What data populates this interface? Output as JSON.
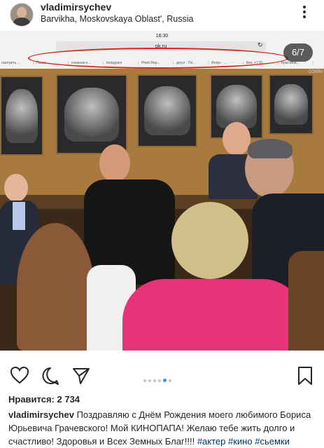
{
  "header": {
    "username": "vladimirsychev",
    "location": "Barvikha, Moskovskaya Oblast', Russia"
  },
  "screenshot_overlay": {
    "time": "16:30",
    "url": "ok.ru",
    "tabs": [
      "смотреть ...",
      "Поиск ...",
      "снежная к...",
      "Instagram",
      "Ptrett Rep...",
      "досуг · По...",
      "Фокус · ...",
      "Без, +7 91...",
      "Кристина..."
    ],
    "watermark": "СОХРА"
  },
  "media": {
    "counter": "6/7"
  },
  "carousel": {
    "total": 6,
    "active_index": 4
  },
  "likes": {
    "text": "Нравится: 2 734"
  },
  "caption": {
    "username": "vladimirsychev",
    "text": "Поздравляю с Днём Рождения моего любимого Бориса Юрьевича  Грачевского! Мой КИНОПАПА! Желаю тебе жить долго и счастливо! Здоровья и Всех Земных Благ!!!! ",
    "hashtags": [
      "#актер",
      "#кино",
      "#сьемки"
    ]
  },
  "colors": {
    "accent": "#3897f0",
    "text": "#262626",
    "hashtag": "#003569",
    "highlight_ring": "#d9261c"
  },
  "icons": [
    "more-icon",
    "heart-icon",
    "comment-icon",
    "share-icon",
    "bookmark-icon"
  ]
}
